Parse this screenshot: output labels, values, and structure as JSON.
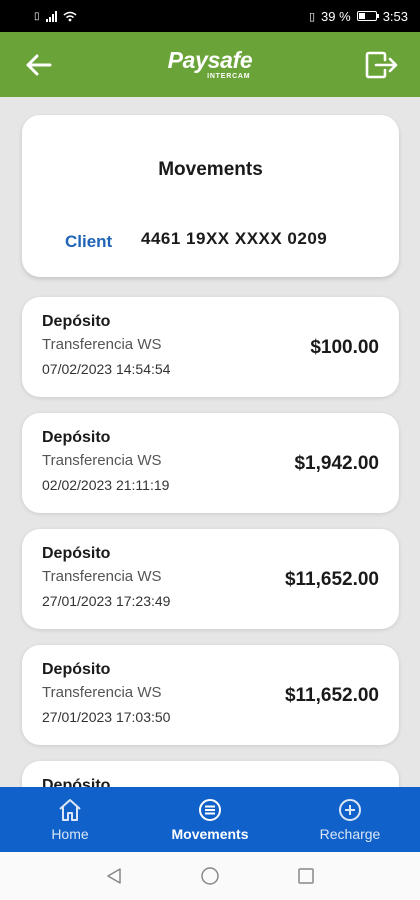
{
  "status_bar": {
    "battery": "39 %",
    "battery_level": 0.39,
    "time": "3:53"
  },
  "header": {
    "logo": "Paysafe",
    "logo_sub": "INTERCAM"
  },
  "account": {
    "title": "Movements",
    "client_label": "Client",
    "card_number": "4461 19XX XXXX 0209"
  },
  "movements": [
    {
      "type": "Depósito",
      "description": "Transferencia WS",
      "date": "07/02/2023 14:54:54",
      "amount": "$100.00"
    },
    {
      "type": "Depósito",
      "description": "Transferencia WS",
      "date": "02/02/2023 21:11:19",
      "amount": "$1,942.00"
    },
    {
      "type": "Depósito",
      "description": "Transferencia WS",
      "date": "27/01/2023 17:23:49",
      "amount": "$11,652.00"
    },
    {
      "type": "Depósito",
      "description": "Transferencia WS",
      "date": "27/01/2023 17:03:50",
      "amount": "$11,652.00"
    },
    {
      "type": "Depósito",
      "description": "",
      "date": "",
      "amount": ""
    }
  ],
  "bottom_nav": {
    "home": "Home",
    "movements": "Movements",
    "recharge": "Recharge"
  },
  "colors": {
    "header": "#6aa338",
    "nav": "#1061c9",
    "client_label": "#1f64b7"
  }
}
